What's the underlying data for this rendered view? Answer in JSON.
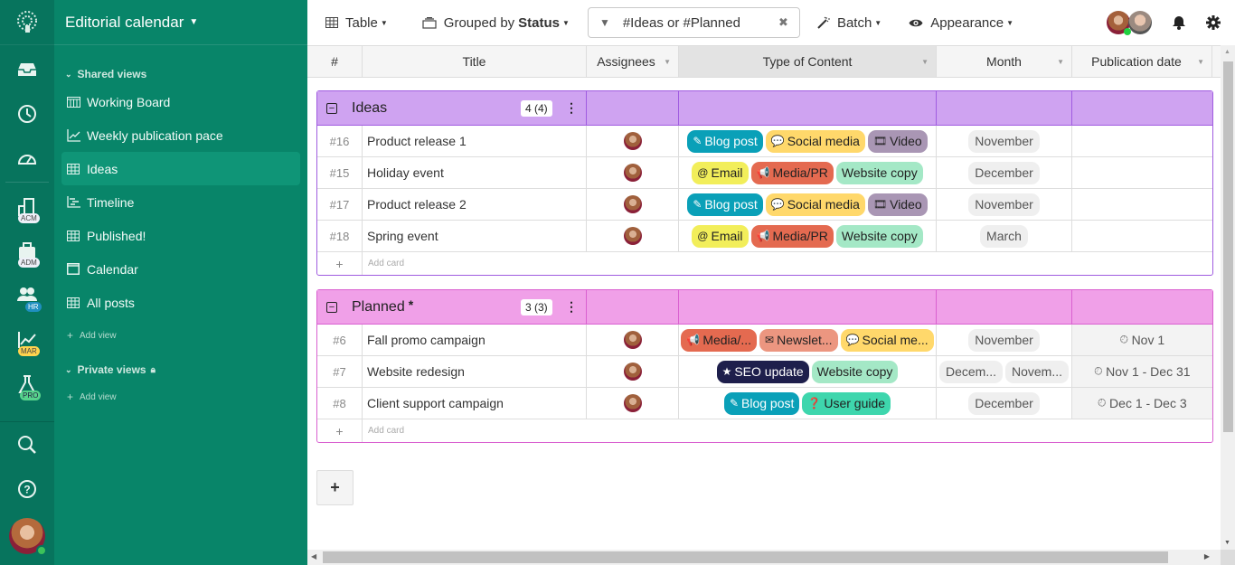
{
  "app": {
    "title": "Editorial calendar"
  },
  "rail": {
    "items": [
      {
        "name": "inbox-icon"
      },
      {
        "name": "clock-icon"
      },
      {
        "name": "dashboard-icon"
      }
    ],
    "workspaces": [
      {
        "icon": "building-icon",
        "badge": "ACM",
        "badge_bg": "#eef0f8",
        "badge_fg": "#444"
      },
      {
        "icon": "briefcase-icon",
        "badge": "ADM",
        "badge_bg": "#eef0f8",
        "badge_fg": "#444"
      },
      {
        "icon": "people-icon",
        "badge": "HR",
        "badge_bg": "#1f8fc0",
        "badge_fg": "#fff"
      },
      {
        "icon": "chart-icon",
        "badge": "MAR",
        "badge_bg": "#ffd34e",
        "badge_fg": "#444"
      },
      {
        "icon": "flask-icon",
        "badge": "PRO",
        "badge_bg": "#57d38c",
        "badge_fg": "#224"
      }
    ]
  },
  "sidebar": {
    "shared_header": "Shared views",
    "shared_views": [
      {
        "label": "Working Board",
        "icon": "board"
      },
      {
        "label": "Weekly publication pace",
        "icon": "chart"
      },
      {
        "label": "Ideas",
        "icon": "table",
        "active": true
      },
      {
        "label": "Timeline",
        "icon": "timeline"
      },
      {
        "label": "Published!",
        "icon": "table"
      },
      {
        "label": "Calendar",
        "icon": "calendar"
      },
      {
        "label": "All posts",
        "icon": "table"
      }
    ],
    "add_view": "Add view",
    "private_header": "Private views",
    "add_view_private": "Add view"
  },
  "toolbar": {
    "table_label": "Table",
    "grouped_prefix": "Grouped by",
    "grouped_field": "Status",
    "filter_text": "#Ideas or #Planned",
    "batch_label": "Batch",
    "appearance_label": "Appearance"
  },
  "columns": [
    {
      "label": "#"
    },
    {
      "label": "Title"
    },
    {
      "label": "Assignees"
    },
    {
      "label": "Type of Content"
    },
    {
      "label": "Month"
    },
    {
      "label": "Publication date"
    }
  ],
  "tag_colors": {
    "Blog post": {
      "bg": "#0aa0b8",
      "fg": "#fff",
      "icon": "✎"
    },
    "Social media": {
      "bg": "#ffd86b",
      "fg": "#222",
      "icon": "💬"
    },
    "Video": {
      "bg": "#a996b4",
      "fg": "#222",
      "icon": "🎞"
    },
    "Email": {
      "bg": "#f2ee5a",
      "fg": "#222",
      "icon": "@"
    },
    "Media/PR": {
      "bg": "#e46a50",
      "fg": "#222",
      "icon": "📢"
    },
    "Website copy": {
      "bg": "#a4e8c6",
      "fg": "#222",
      "icon": ""
    },
    "Newsletter": {
      "bg": "#ec9680",
      "fg": "#222",
      "icon": "✉"
    },
    "SEO update": {
      "bg": "#1e1f4c",
      "fg": "#fff",
      "icon": "★"
    },
    "User guide": {
      "bg": "#3ed6ad",
      "fg": "#222",
      "icon": "❓"
    }
  },
  "groups": [
    {
      "name": "Ideas",
      "starred": false,
      "count": "4 (4)",
      "rows": [
        {
          "id": "#16",
          "title": "Product release 1",
          "types": [
            "Blog post",
            "Social media",
            "Video"
          ],
          "months": [
            "November"
          ],
          "pub": ""
        },
        {
          "id": "#15",
          "title": "Holiday event",
          "types": [
            "Email",
            "Media/PR",
            "Website copy"
          ],
          "months": [
            "December"
          ],
          "pub": ""
        },
        {
          "id": "#17",
          "title": "Product release 2",
          "types": [
            "Blog post",
            "Social media",
            "Video"
          ],
          "months": [
            "November"
          ],
          "pub": ""
        },
        {
          "id": "#18",
          "title": "Spring event",
          "types": [
            "Email",
            "Media/PR",
            "Website copy"
          ],
          "months": [
            "March"
          ],
          "pub": ""
        }
      ],
      "add_card": "Add card"
    },
    {
      "name": "Planned",
      "starred": true,
      "count": "3 (3)",
      "rows": [
        {
          "id": "#6",
          "title": "Fall promo campaign",
          "types": [
            "Media/PR",
            "Newsletter",
            "Social media"
          ],
          "type_labels": [
            "Media/...",
            "Newslet...",
            "Social me..."
          ],
          "months": [
            "November"
          ],
          "pub": "Nov 1"
        },
        {
          "id": "#7",
          "title": "Website redesign",
          "types": [
            "SEO update",
            "Website copy"
          ],
          "months": [
            "Decem...",
            "Novem..."
          ],
          "pub": "Nov 1 - Dec 31"
        },
        {
          "id": "#8",
          "title": "Client support campaign",
          "types": [
            "Blog post",
            "User guide"
          ],
          "months": [
            "December"
          ],
          "pub": "Dec 1 - Dec 3"
        }
      ],
      "add_card": "Add card"
    }
  ],
  "add_group": "+"
}
